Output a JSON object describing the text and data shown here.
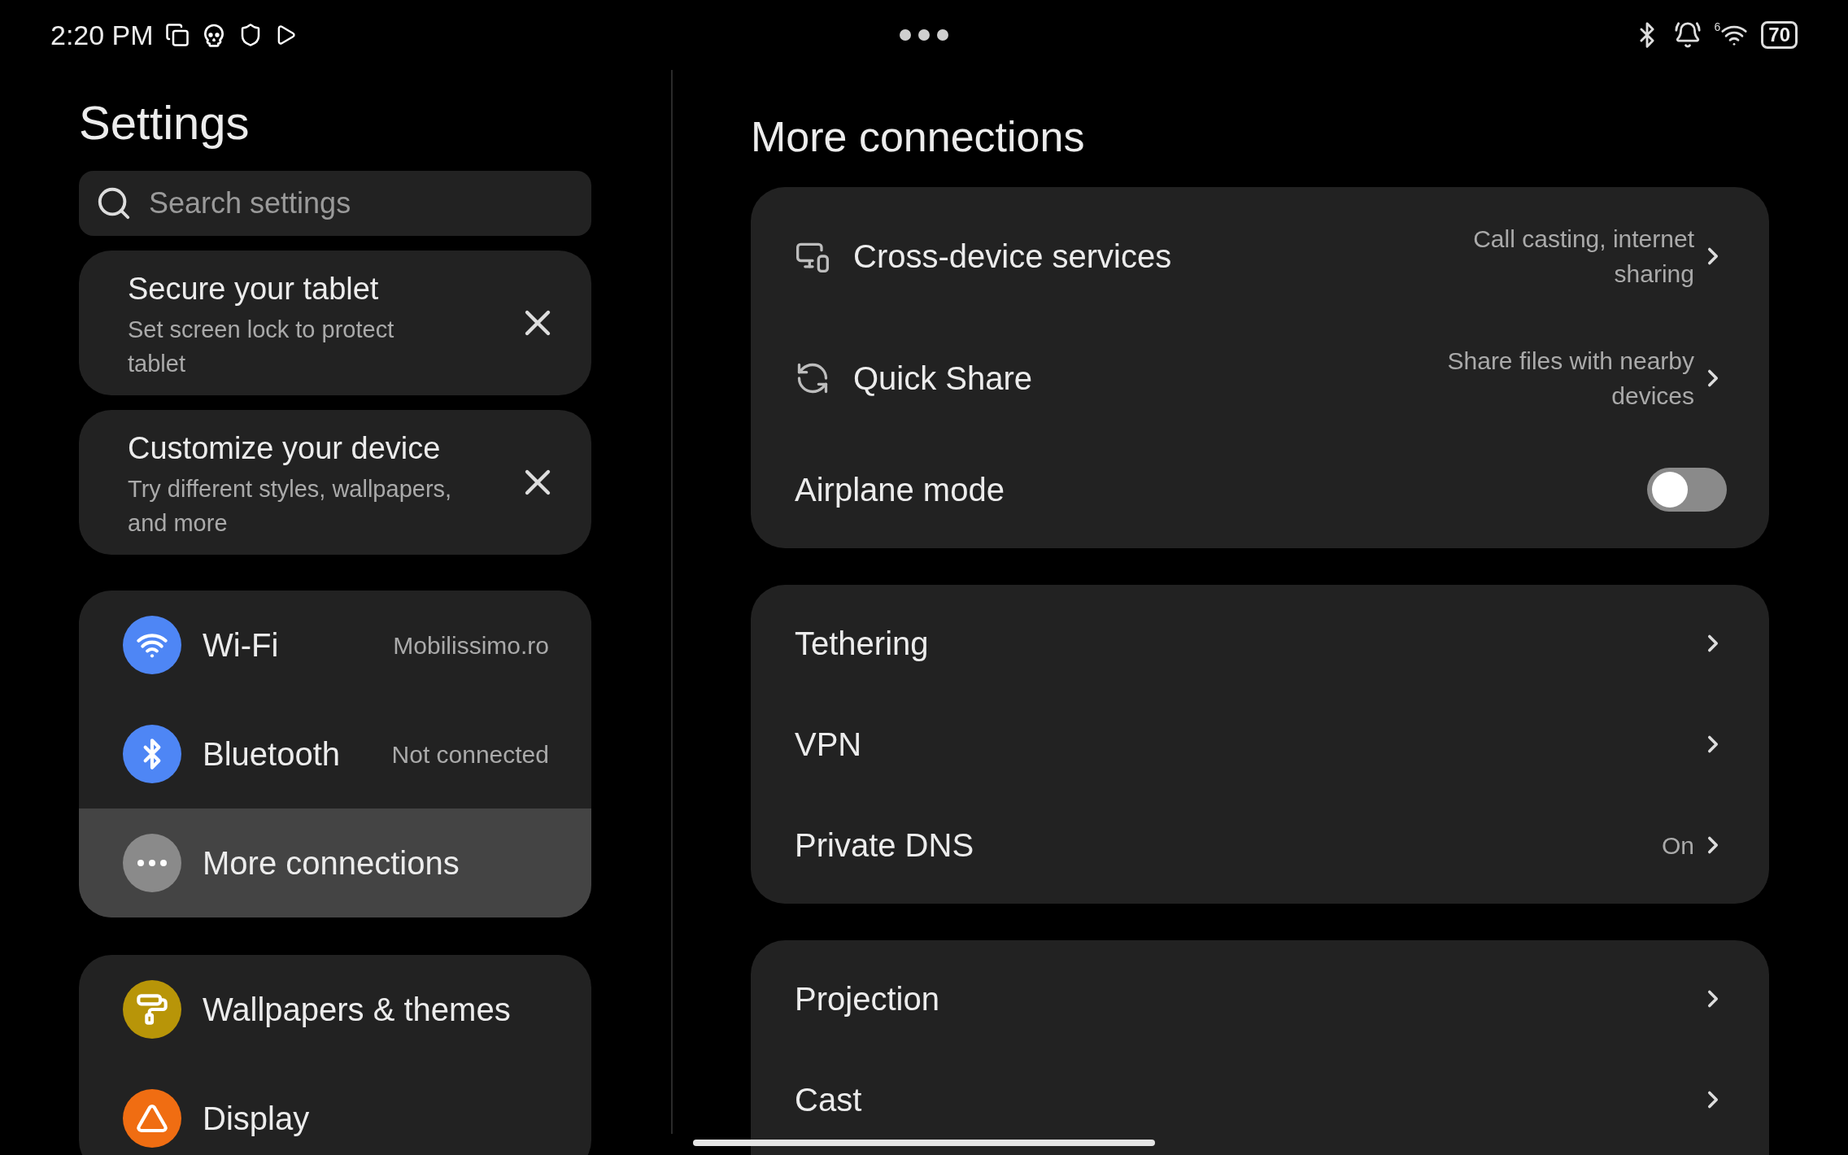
{
  "status_bar": {
    "time": "2:20 PM",
    "wifi_generation": "6",
    "battery": "70"
  },
  "sidebar": {
    "title": "Settings",
    "search": {
      "placeholder": "Search settings"
    },
    "suggestions": [
      {
        "title": "Secure your tablet",
        "text": "Set screen lock to protect tablet"
      },
      {
        "title": "Customize your device",
        "text": "Try different styles, wallpapers, and more"
      }
    ],
    "groups": [
      {
        "items": [
          {
            "kind": "wifi",
            "label": "Wi-Fi",
            "value": "Mobilissimo.ro",
            "color": "#4e86f5",
            "selected": false
          },
          {
            "kind": "bluetooth",
            "label": "Bluetooth",
            "value": "Not connected",
            "color": "#4e86f5",
            "selected": false
          },
          {
            "kind": "more",
            "label": "More connections",
            "color": "#8a8a8a",
            "selected": true
          }
        ]
      },
      {
        "items": [
          {
            "kind": "wallpaper",
            "label": "Wallpapers & themes",
            "color": "#b89508",
            "selected": false
          },
          {
            "kind": "display",
            "label": "Display",
            "color": "#f06d12",
            "selected": false
          }
        ]
      }
    ]
  },
  "main": {
    "title": "More connections",
    "groups": [
      {
        "rows": [
          {
            "kind": "devices",
            "label": "Cross-device services",
            "value": "Call casting, internet sharing"
          },
          {
            "kind": "share",
            "label": "Quick Share",
            "value": "Share files with nearby devices"
          },
          {
            "kind": "toggle",
            "label": "Airplane mode",
            "on": false
          }
        ]
      },
      {
        "rows": [
          {
            "kind": "link",
            "label": "Tethering"
          },
          {
            "kind": "link",
            "label": "VPN"
          },
          {
            "kind": "link",
            "label": "Private DNS",
            "value": "On"
          }
        ]
      },
      {
        "rows": [
          {
            "kind": "link",
            "label": "Projection"
          },
          {
            "kind": "link",
            "label": "Cast"
          }
        ]
      }
    ]
  }
}
